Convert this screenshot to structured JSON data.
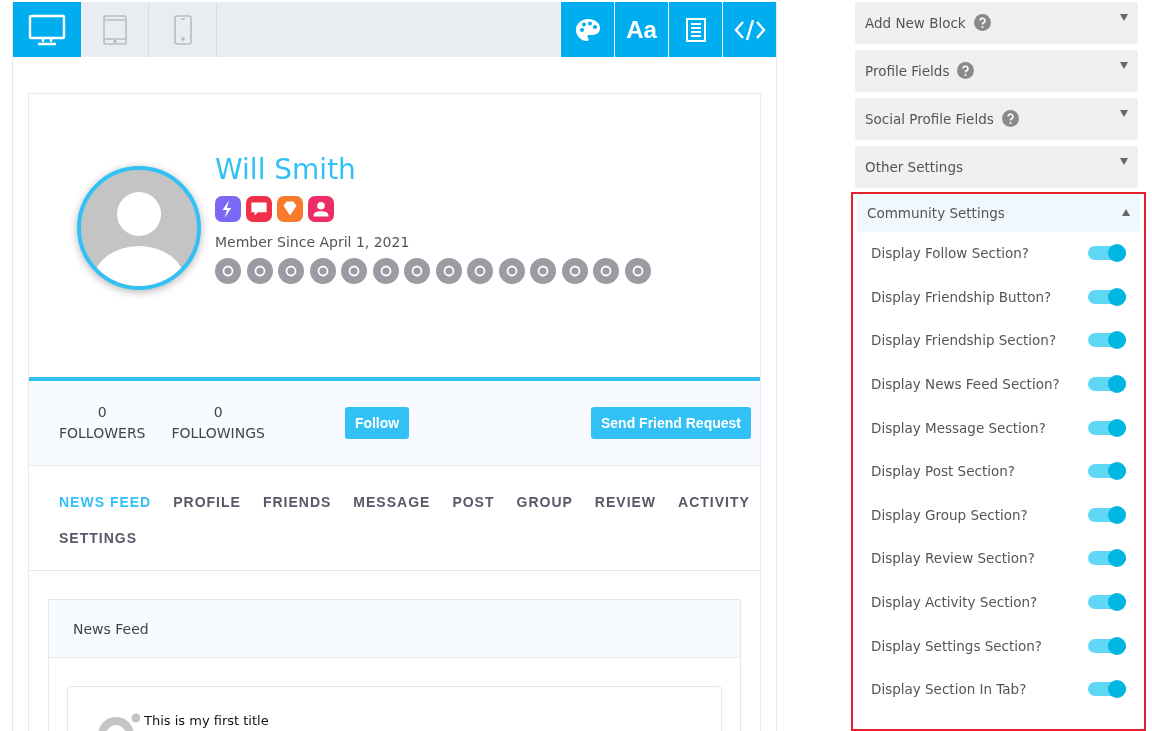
{
  "toolbar": {
    "devices": [
      {
        "kind": "desktop",
        "selected": true
      },
      {
        "kind": "tablet",
        "selected": false
      },
      {
        "kind": "mobile",
        "selected": false
      }
    ],
    "tools": [
      {
        "kind": "palette"
      },
      {
        "kind": "font",
        "label": "Aa"
      },
      {
        "kind": "layout"
      },
      {
        "kind": "code"
      }
    ]
  },
  "profile": {
    "name": "Will Smith",
    "badges": [
      {
        "kind": "bolt",
        "color": "#7b68f5"
      },
      {
        "kind": "chat",
        "color": "#f0304a"
      },
      {
        "kind": "diamond",
        "color": "#f97a2c"
      },
      {
        "kind": "user",
        "color": "#ee2c66"
      }
    ],
    "member_since": "Member Since April 1, 2021",
    "stats": [
      {
        "value": "0",
        "label": "FOLLOWERS"
      },
      {
        "value": "0",
        "label": "FOLLOWINGS"
      }
    ],
    "follow_button": "Follow",
    "friend_button": "Send Friend Request",
    "tabs": [
      {
        "label": "NEWS FEED",
        "selected": true
      },
      {
        "label": "PROFILE",
        "selected": false
      },
      {
        "label": "FRIENDS",
        "selected": false
      },
      {
        "label": "MESSAGE",
        "selected": false
      },
      {
        "label": "POST",
        "selected": false
      },
      {
        "label": "GROUP",
        "selected": false
      },
      {
        "label": "REVIEW",
        "selected": false
      },
      {
        "label": "ACTIVITY",
        "selected": false
      },
      {
        "label": "SETTINGS",
        "selected": false
      }
    ],
    "news_feed": {
      "title": "News Feed",
      "post_title": "This is my first title"
    }
  },
  "sidebar": {
    "sections": [
      {
        "title": "Add New Block",
        "help": true,
        "expanded": false
      },
      {
        "title": "Profile Fields",
        "help": true,
        "expanded": false
      },
      {
        "title": "Social Profile Fields",
        "help": true,
        "expanded": false
      },
      {
        "title": "Other Settings",
        "help": false,
        "expanded": false
      },
      {
        "title": "Community Settings",
        "help": false,
        "expanded": true
      }
    ],
    "settings": [
      {
        "label": "Display Follow Section?",
        "on": true
      },
      {
        "label": "Display Friendship Button?",
        "on": true
      },
      {
        "label": "Display Friendship Section?",
        "on": true
      },
      {
        "label": "Display News Feed Section?",
        "on": true
      },
      {
        "label": "Display Message Section?",
        "on": true
      },
      {
        "label": "Display Post Section?",
        "on": true
      },
      {
        "label": "Display Group Section?",
        "on": true
      },
      {
        "label": "Display Review Section?",
        "on": true
      },
      {
        "label": "Display Activity Section?",
        "on": true
      },
      {
        "label": "Display Settings Section?",
        "on": true
      },
      {
        "label": "Display Section In Tab?",
        "on": true
      }
    ]
  }
}
